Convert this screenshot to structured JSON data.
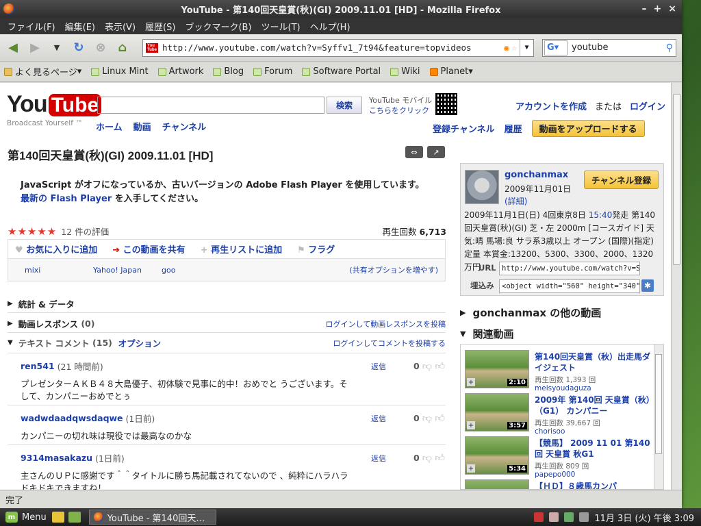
{
  "window": {
    "title": "YouTube - 第140回天皇賞(秋)(GI) 2009.11.01 [HD] - Mozilla Firefox",
    "buttons": [
      "–",
      "+",
      "×"
    ]
  },
  "menubar": [
    "ファイル(F)",
    "編集(E)",
    "表示(V)",
    "履歴(S)",
    "ブックマーク(B)",
    "ツール(T)",
    "ヘルプ(H)"
  ],
  "nav": {
    "url": "http://www.youtube.com/watch?v=Syffv1_7t94&feature=topvideos",
    "search_value": "youtube",
    "search_engine_letter": "G"
  },
  "bookmarks": [
    "よく見るページ",
    "Linux Mint",
    "Artwork",
    "Blog",
    "Forum",
    "Software Portal",
    "Wiki",
    "Planet"
  ],
  "yt": {
    "logo_you": "You",
    "logo_tube": "Tube",
    "slogan": "Broadcast Yourself ™",
    "search_button": "検索",
    "mobile_line1": "YouTube モバイル",
    "mobile_line2": "こちらをクリック",
    "topnav": [
      "ホーム",
      "動画",
      "チャンネル"
    ],
    "create_account": "アカウントを作成",
    "or": "または",
    "login": "ログイン",
    "subscriptions": "登録チャンネル",
    "history": "履歴",
    "upload": "動画をアップロードする"
  },
  "video": {
    "title": "第140回天皇賞(秋)(GI) 2009.11.01 [HD]",
    "flash_msg_a": "JavaScript がオフになっているか、古いバージョンの Adobe Flash Player を使用しています。",
    "flash_link": "最新の Flash Player",
    "flash_msg_b": "を入手してください。",
    "stars": "★★★★★",
    "rating_count": "12 件の評価",
    "views_label": "再生回数",
    "views": "6,713",
    "views_unit": "回",
    "actions": [
      "お気に入りに追加",
      "この動画を共有",
      "再生リストに追加",
      "フラグ"
    ],
    "share_sites": [
      "mixi",
      "Yahoo! Japan",
      "goo"
    ],
    "more_share": "(共有オプションを増やす)"
  },
  "sections": {
    "stats": "統計 & データ",
    "responses": "動画レスポンス",
    "responses_count": "(0)",
    "responses_link": "ログインして動画レスポンスを投稿",
    "comments": "テキスト コメント",
    "comments_count": "(15)",
    "options": "オプション",
    "comments_link": "ログインしてコメントを投稿する"
  },
  "comments": [
    {
      "user": "ren541",
      "time": "(21 時間前)",
      "reply": "返信",
      "score": "0",
      "body": "プレゼンターＡＫＢ４８大島優子、初体験で見事に的中！おめでと うございます。そして、カンパニーおめでとぅ"
    },
    {
      "user": "wadwdaadqwsdaqwe",
      "time": "(1日前)",
      "reply": "返信",
      "score": "0",
      "body": "カンパニーの切れ味は現役では最高なのかな"
    },
    {
      "user": "9314masakazu",
      "time": "(1日前)",
      "reply": "返信",
      "score": "0",
      "body": "主さんのＵＰに感謝です＾＾タイトルに勝ち馬記載されてないので 、純粋にハラハラドキドキできますね！"
    }
  ],
  "channel": {
    "name": "gonchanmax",
    "date": "2009年11月01日",
    "detail": "(詳細)",
    "subscribe": "チャンネル登録",
    "desc_a": "2009年11月1日(日) 4回東京8日",
    "desc_time": "15:40",
    "desc_b": "発走 第140回天皇賞(秋)(GI) 芝・左 2000m [コースガイド] 天気:晴 馬場:良 サラ系3歳以上 オープン (国際)(指定) 定量 本賞金:13200、5300、3300、2000、1320万円",
    "url_label": "URL",
    "url_value": "http://www.youtube.com/watch?v=Syffv1_7t",
    "embed_label": "埋込み",
    "embed_value": "<object width=\"560\" height=\"340\"><param"
  },
  "right": {
    "more_from": "gonchanmax の他の動画",
    "related": "関連動画"
  },
  "related_videos": [
    {
      "title": "第140回天皇賞（秋）出走馬ダイジェスト",
      "views": "再生回数 1,393 回",
      "user": "meisyoudaguza",
      "duration": "2:10"
    },
    {
      "title": "2009年 第140回 天皇賞（秋）（G1） カンパニー",
      "views": "再生回数 39,667 回",
      "user": "chorisoo",
      "duration": "3:57"
    },
    {
      "title": "【競馬】 2009 11 01 第140回 天皇賞 秋G1",
      "views": "再生回数 809 回",
      "user": "papepo000",
      "duration": "5:34"
    },
    {
      "title": "【ＨＤ】８歳馬カンパ",
      "views": "",
      "user": "",
      "duration": ""
    }
  ],
  "status": "完了",
  "taskbar": {
    "menu": "Menu",
    "task": "YouTube - 第140回天…",
    "clock": "11月 3日 (火) 午後 3:09"
  }
}
